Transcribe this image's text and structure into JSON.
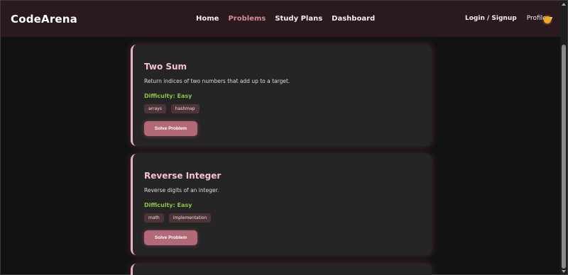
{
  "navbar": {
    "brand": "CodeArena",
    "links": [
      {
        "label": "Home",
        "active": false
      },
      {
        "label": "Problems",
        "active": true
      },
      {
        "label": "Study Plans",
        "active": false
      },
      {
        "label": "Dashboard",
        "active": false
      }
    ],
    "login_label": "Login / Signup",
    "profile_label": "Profile",
    "theme_icon": "sun-icon"
  },
  "colors": {
    "navbar_bg": "#2a1a1e",
    "accent": "#d98a9a",
    "card_title": "#f4c2cc",
    "easy": "#8bc34a",
    "button": "#b26a78"
  },
  "problems": [
    {
      "title": "Two Sum",
      "description": "Return indices of two numbers that add up to a target.",
      "difficulty": "Difficulty: Easy",
      "tags": [
        "arrays",
        "hashmap"
      ],
      "action_label": "Solve Problem"
    },
    {
      "title": "Reverse Integer",
      "description": "Reverse digits of an integer.",
      "difficulty": "Difficulty: Easy",
      "tags": [
        "math",
        "implementation"
      ],
      "action_label": "Solve Problem"
    }
  ]
}
